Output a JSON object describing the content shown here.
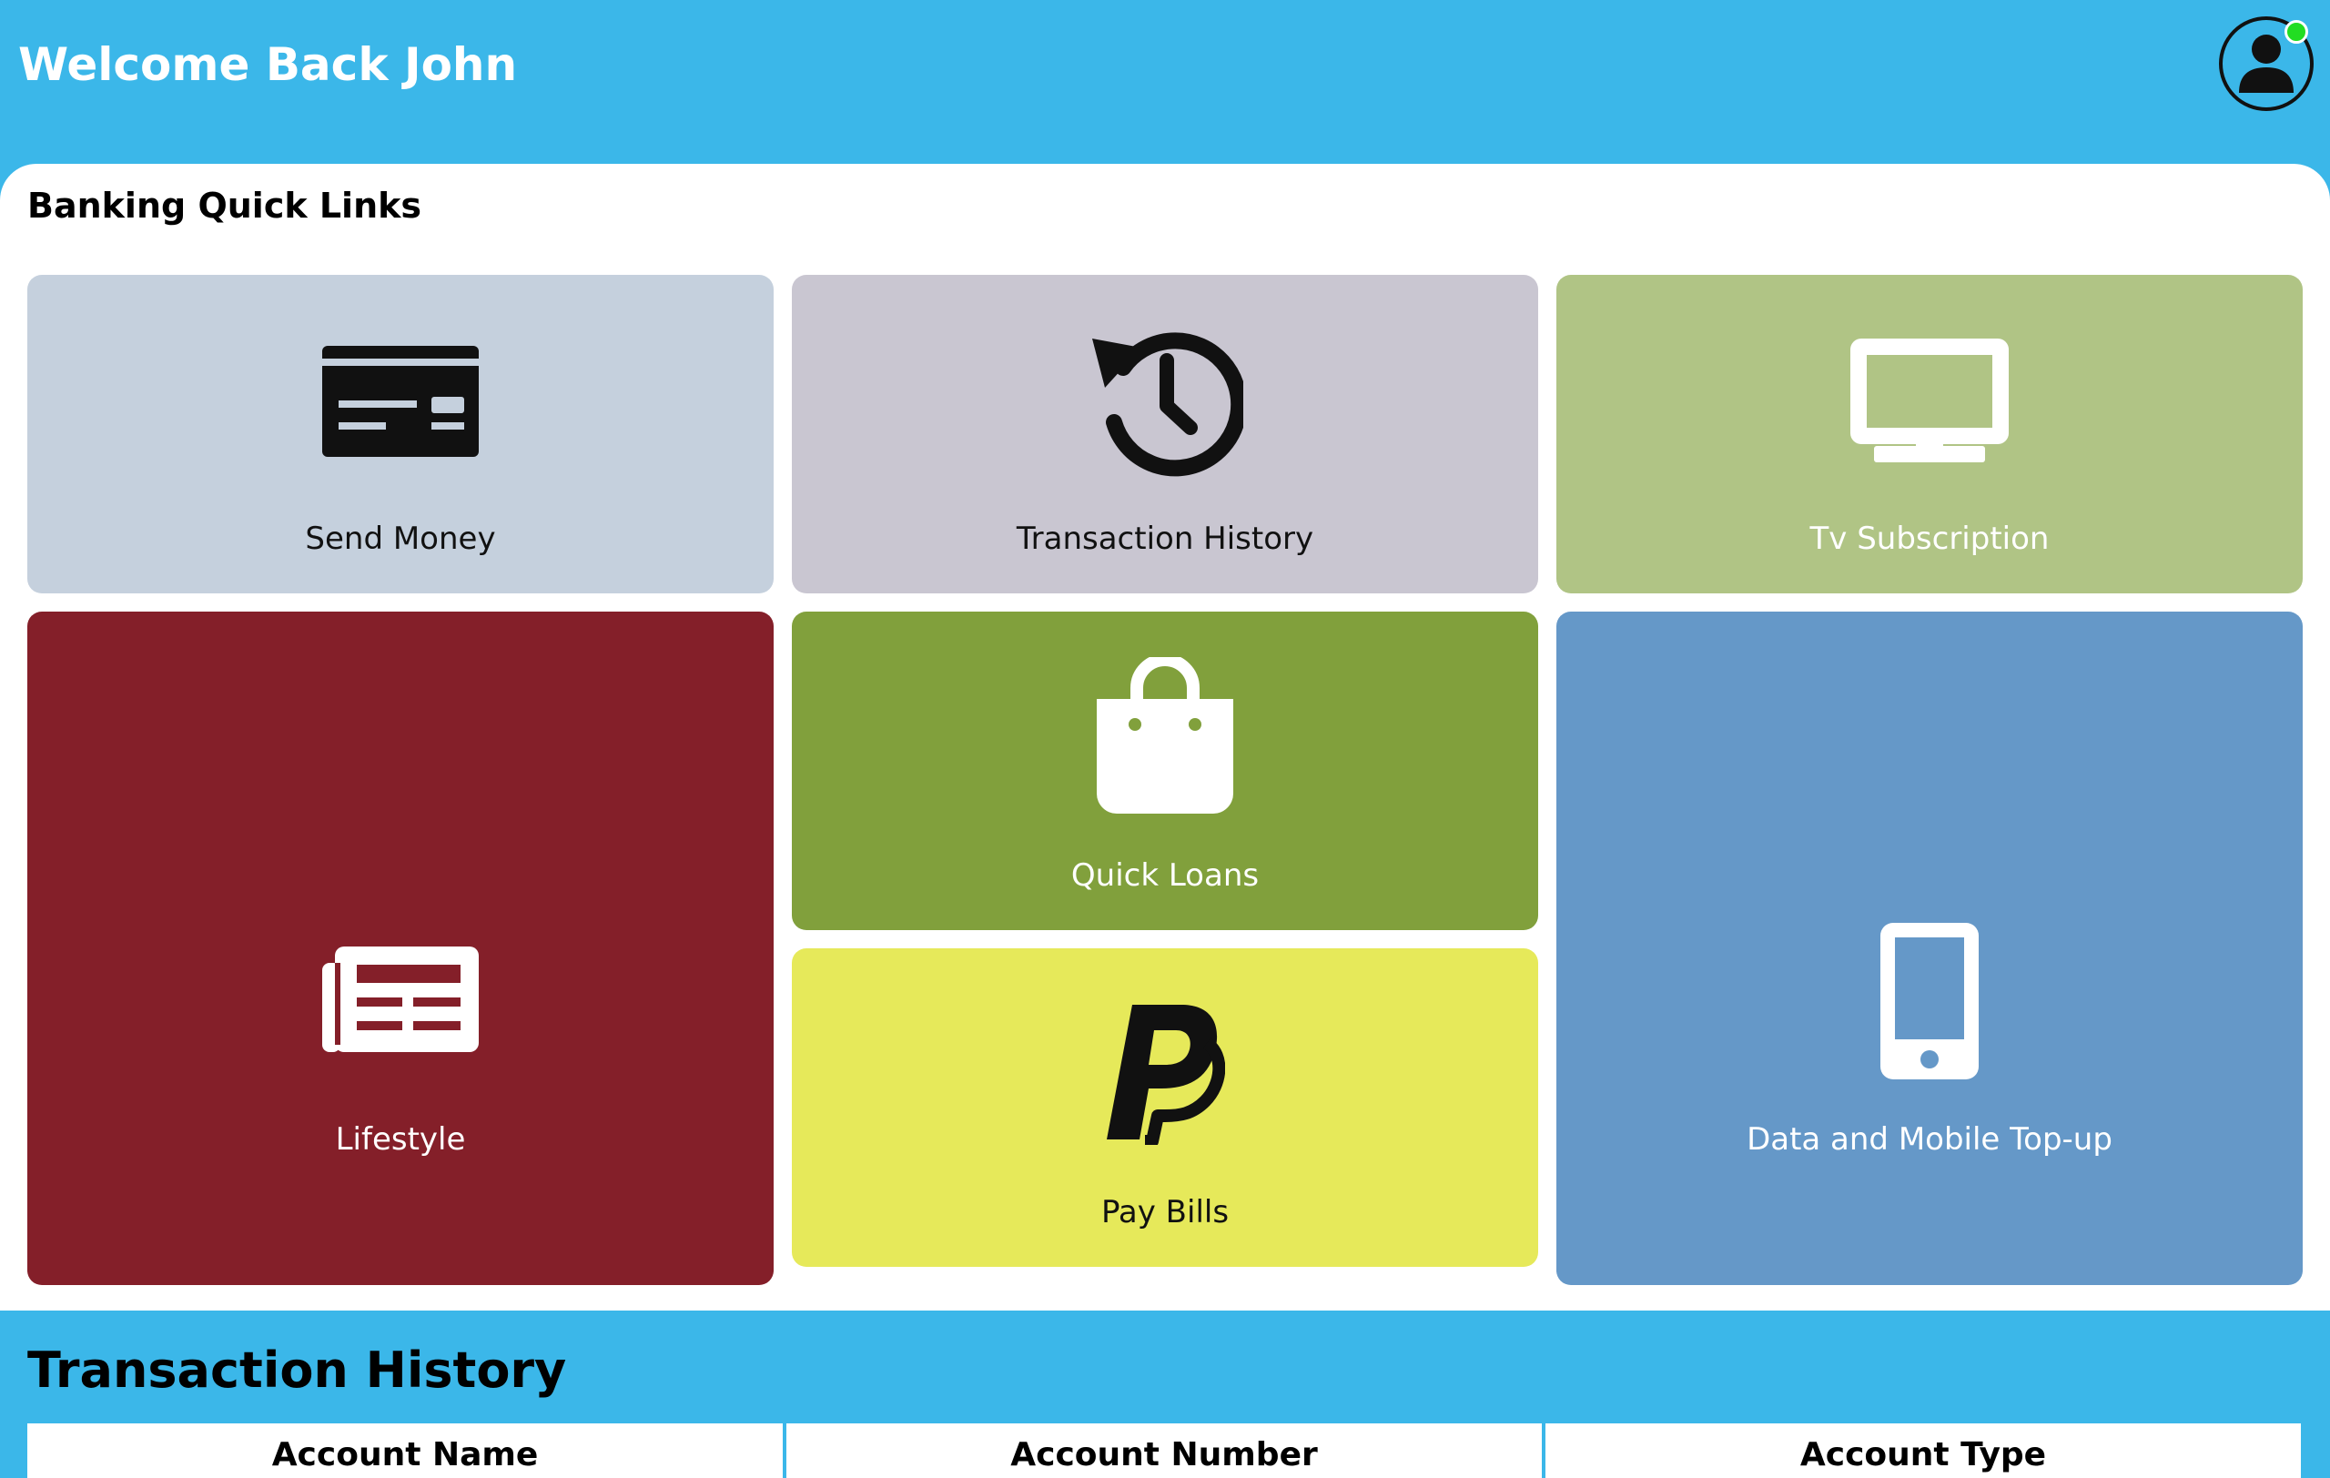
{
  "header": {
    "welcome_text": "Welcome Back John",
    "avatar_icon": "user-avatar-icon",
    "status": "online",
    "status_color": "#22dd22"
  },
  "quick_links": {
    "title": "Banking Quick Links",
    "tiles": [
      {
        "label": "Send Money",
        "icon": "credit-card-icon",
        "color": "#c5d0dd",
        "text_color": "#111111"
      },
      {
        "label": "Transaction History",
        "icon": "history-icon",
        "color": "#c9c6d1",
        "text_color": "#111111"
      },
      {
        "label": "Tv Subscription",
        "icon": "tv-icon",
        "color": "#b0c485",
        "text_color": "#ffffff"
      },
      {
        "label": "Lifestyle",
        "icon": "newspaper-icon",
        "color": "#841f29",
        "text_color": "#ffffff"
      },
      {
        "label": "Quick Loans",
        "icon": "shopping-bag-icon",
        "color": "#81a03c",
        "text_color": "#ffffff"
      },
      {
        "label": "Pay Bills",
        "icon": "paypal-icon",
        "color": "#e6e95a",
        "text_color": "#111111"
      },
      {
        "label": "Data and Mobile Top-up",
        "icon": "mobile-phone-icon",
        "color": "#6598c8",
        "text_color": "#ffffff"
      }
    ]
  },
  "transaction_history": {
    "title": "Transaction History",
    "columns": [
      "Account Name",
      "Account Number",
      "Account Type"
    ]
  },
  "colors": {
    "primary": "#3bb7e9",
    "panel": "#ffffff"
  }
}
